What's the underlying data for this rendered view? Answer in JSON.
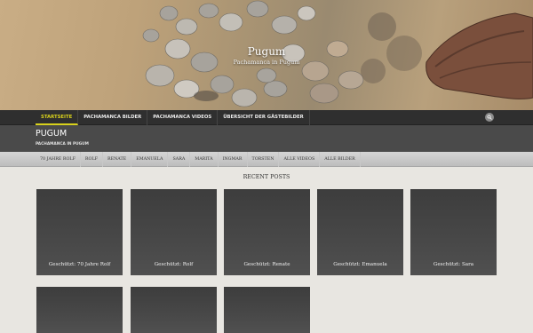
{
  "hero": {
    "title": "Pugum",
    "subtitle": "Pachamanca in Pugum"
  },
  "topnav": {
    "items": [
      {
        "label": "Startseite",
        "active": true
      },
      {
        "label": "Pachamanca Bilder",
        "active": false
      },
      {
        "label": "Pachamanca Videos",
        "active": false
      },
      {
        "label": "Übersicht der Gästebilder",
        "active": false
      }
    ],
    "search_icon": "search-icon"
  },
  "site": {
    "title": "PUGUM",
    "tagline": "PACHAMANCA IN PUGUM"
  },
  "subnav": {
    "items": [
      {
        "label": "70 Jahre Rolf"
      },
      {
        "label": "Rolf"
      },
      {
        "label": "Renate"
      },
      {
        "label": "Emanuela"
      },
      {
        "label": "Sara"
      },
      {
        "label": "Marita"
      },
      {
        "label": "Ingmar"
      },
      {
        "label": "Torsten"
      },
      {
        "label": "Alle Videos"
      },
      {
        "label": "Alle Bilder"
      }
    ]
  },
  "recent_posts": {
    "heading": "RECENT POSTS",
    "posts": [
      {
        "title": "Geschützt: 70 Jahre Rolf"
      },
      {
        "title": "Geschützt: Rolf"
      },
      {
        "title": "Geschützt: Renate"
      },
      {
        "title": "Geschützt: Emanuela"
      },
      {
        "title": "Geschützt: Sara"
      },
      {
        "title": ""
      },
      {
        "title": ""
      },
      {
        "title": ""
      }
    ]
  },
  "colors": {
    "accent": "#d8d11c",
    "topnav_bg": "#2f2f2f",
    "header_bg": "#4a4a4a",
    "card_bg": "#454545",
    "page_bg": "#e8e6e1"
  }
}
